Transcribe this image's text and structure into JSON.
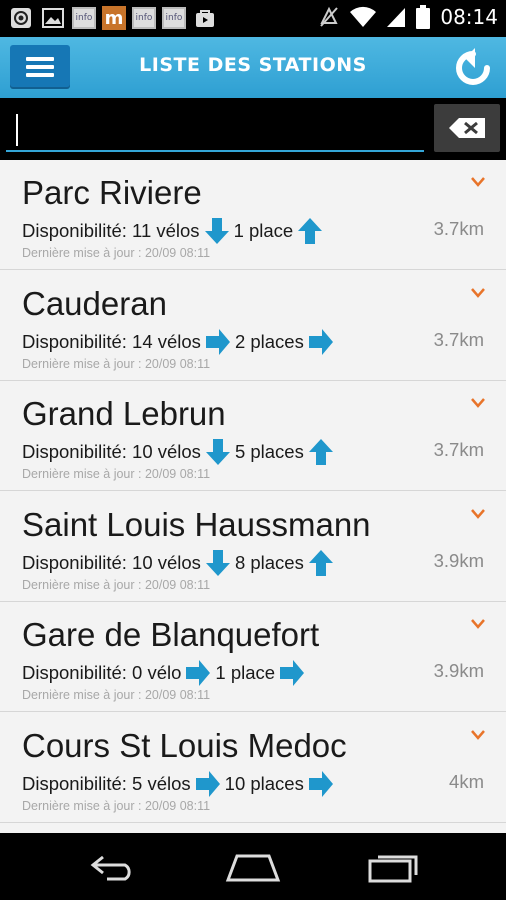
{
  "status_bar": {
    "time": "08:14",
    "notification_icons": [
      "target-icon",
      "image-icon",
      "info-icon",
      "m-app-icon",
      "info-icon",
      "info-icon",
      "bag-icon"
    ],
    "m_label": "m",
    "info_label": "info"
  },
  "header": {
    "title": "LISTE DES STATIONS",
    "accent_color": "#2e9fd2"
  },
  "search": {
    "value": "",
    "placeholder": ""
  },
  "stations": [
    {
      "name": "Parc Riviere",
      "bikes_label": "Disponibilité: 11 vélos",
      "bikes_trend": "down",
      "places_label": "1 place",
      "places_trend": "up",
      "distance": "3.7km",
      "updated": "Dernière mise à jour : 20/09 08:11"
    },
    {
      "name": "Cauderan",
      "bikes_label": "Disponibilité: 14 vélos",
      "bikes_trend": "right",
      "places_label": "2 places",
      "places_trend": "right",
      "distance": "3.7km",
      "updated": "Dernière mise à jour : 20/09 08:11"
    },
    {
      "name": "Grand Lebrun",
      "bikes_label": "Disponibilité: 10 vélos",
      "bikes_trend": "down",
      "places_label": "5 places",
      "places_trend": "up",
      "distance": "3.7km",
      "updated": "Dernière mise à jour : 20/09 08:11"
    },
    {
      "name": "Saint Louis Haussmann",
      "bikes_label": "Disponibilité: 10 vélos",
      "bikes_trend": "down",
      "places_label": "8 places",
      "places_trend": "up",
      "distance": "3.9km",
      "updated": "Dernière mise à jour : 20/09 08:11"
    },
    {
      "name": "Gare de Blanquefort",
      "bikes_label": "Disponibilité: 0 vélo",
      "bikes_trend": "right",
      "places_label": "1 place",
      "places_trend": "right",
      "distance": "3.9km",
      "updated": "Dernière mise à jour : 20/09 08:11"
    },
    {
      "name": "Cours St Louis Medoc",
      "bikes_label": "Disponibilité: 5 vélos",
      "bikes_trend": "right",
      "places_label": "10 places",
      "places_trend": "right",
      "distance": "4km",
      "updated": "Dernière mise à jour : 20/09 08:11"
    }
  ],
  "colors": {
    "arrow": "#1f97cc",
    "chevron": "#e8742a"
  }
}
